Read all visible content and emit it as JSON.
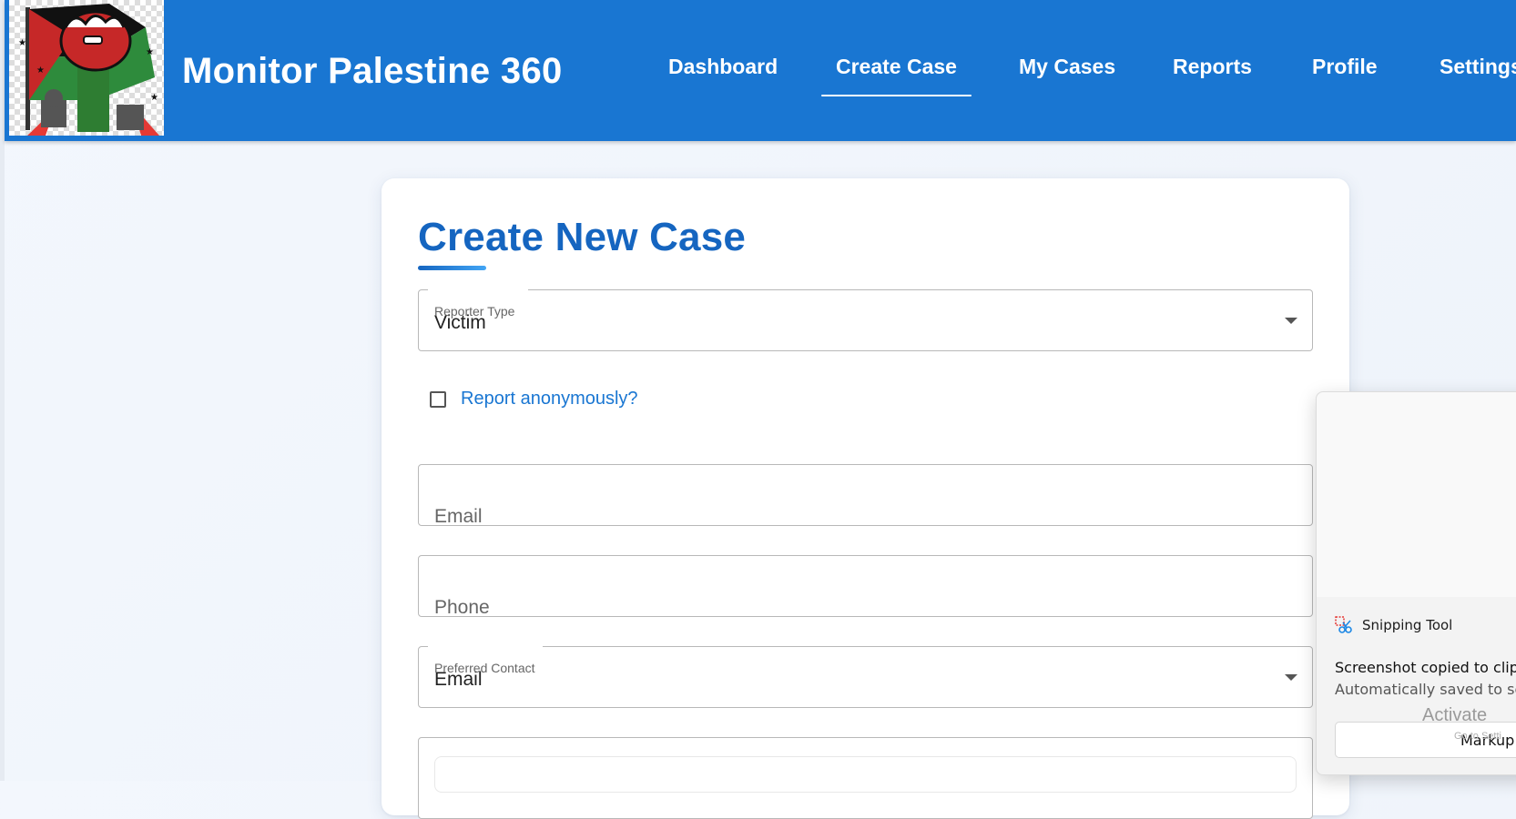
{
  "app": {
    "title": "Monitor Palestine 360"
  },
  "nav": {
    "items": [
      {
        "label": "Dashboard"
      },
      {
        "label": "Create Case",
        "active": true
      },
      {
        "label": "My Cases"
      },
      {
        "label": "Reports"
      },
      {
        "label": "Profile"
      },
      {
        "label": "Settings"
      }
    ]
  },
  "form": {
    "title": "Create New Case",
    "reporter_type": {
      "label": "Reporter Type",
      "value": "Victim"
    },
    "anonymous": {
      "label": "Report anonymously?",
      "checked": false
    },
    "email": {
      "placeholder": "Email"
    },
    "phone": {
      "placeholder": "Phone"
    },
    "preferred_contact": {
      "label": "Preferred Contact",
      "value": "Email"
    }
  },
  "toast": {
    "app_name": "Snipping Tool",
    "title": "Screenshot copied to clipb",
    "body": "Automatically saved to scr",
    "action": "Markup"
  },
  "watermark": {
    "text": "Activate",
    "sub": "Go to Setti"
  },
  "colors": {
    "appbar": "#1976d2",
    "accent": "#1565c0"
  }
}
